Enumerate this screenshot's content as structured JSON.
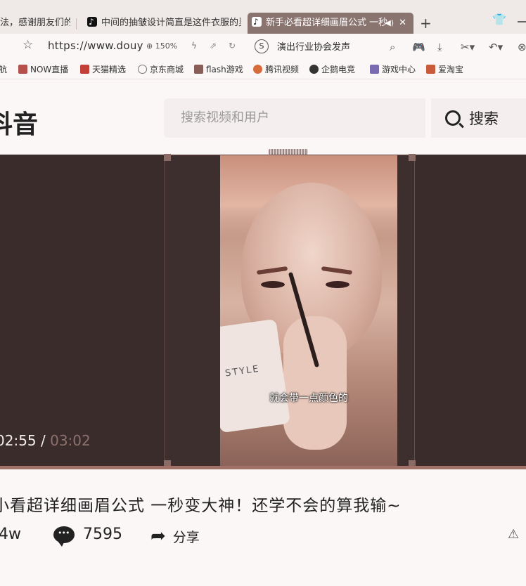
{
  "browser": {
    "tabs": [
      {
        "label": "法，感谢朋友们的",
        "active": false
      },
      {
        "label": "中间的抽皱设计简直是这件衣服的灵",
        "active": false
      },
      {
        "label": "新手必看超详细画眉公式 一秒",
        "active": true
      }
    ],
    "new_tab": "+",
    "tab_close": "✕",
    "url": "https://www.douy",
    "zoom": "150%",
    "news_text": "演出行业协会发声",
    "bookmarks": [
      {
        "label": "航",
        "icon": "nav-icon",
        "color": "#8a6a66"
      },
      {
        "label": "NOW直播",
        "icon": "now-icon",
        "color": "#b5504a"
      },
      {
        "label": "天猫精选",
        "icon": "tmall-icon",
        "color": "#c24038"
      },
      {
        "label": "京东商城",
        "icon": "globe-icon",
        "color": "#777777"
      },
      {
        "label": "flash游戏",
        "icon": "flash-icon",
        "color": "#8a5e58"
      },
      {
        "label": "腾讯视频",
        "icon": "tencent-video-icon",
        "color": "#d86b3c"
      },
      {
        "label": "企鹅电竞",
        "icon": "penguin-icon",
        "color": "#333333"
      },
      {
        "label": "游戏中心",
        "icon": "game-icon",
        "color": "#7a6ab0"
      },
      {
        "label": "爱淘宝",
        "icon": "taobao-icon",
        "color": "#c95a3a"
      }
    ]
  },
  "douyin": {
    "logo": "抖音",
    "search_placeholder": "搜索视频和用户",
    "search_button": "搜索"
  },
  "video": {
    "subtitle": "就会带一点颜色的",
    "current_time": "02:55",
    "time_separator": " / ",
    "total_time": "03:02",
    "mirror_text": "STYLE",
    "title": "小看超详细画眉公式 一秒变大神！还学不会的算我输~",
    "likes": "4w",
    "comments": "7595",
    "share_label": "分享"
  }
}
